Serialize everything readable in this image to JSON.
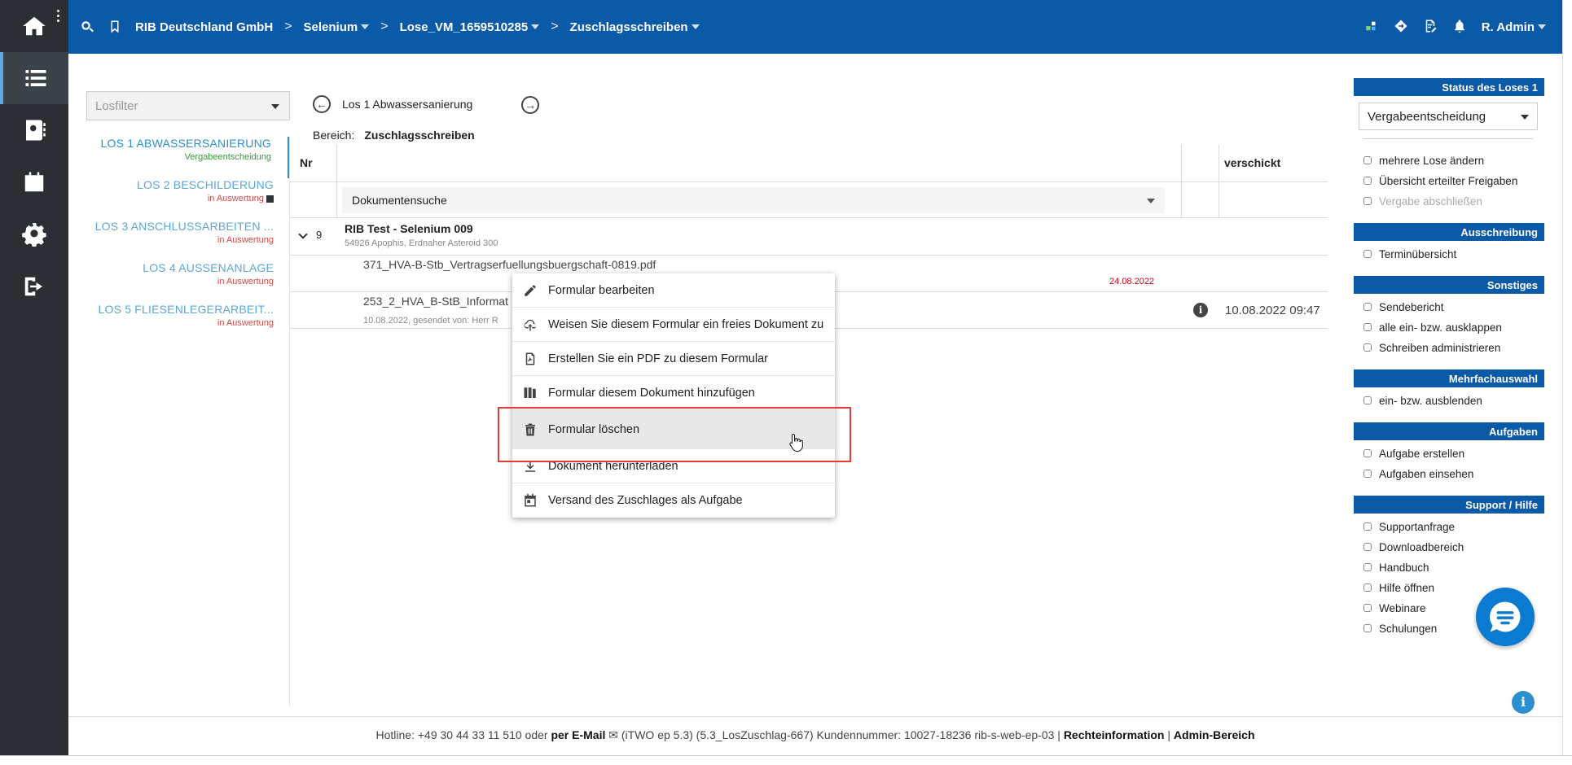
{
  "header": {
    "breadcrumbs": [
      {
        "label": "RIB Deutschland GmbH",
        "dropdown": false
      },
      {
        "label": "Selenium",
        "dropdown": true
      },
      {
        "label": "Lose_VM_1659510285",
        "dropdown": true
      },
      {
        "label": "Zuschlagsschreiben",
        "dropdown": true
      }
    ],
    "user": "R. Admin",
    "colors": {
      "bar": "#0a5aa8"
    }
  },
  "rail": {
    "icons": [
      "home-icon",
      "list-icon",
      "contact-book-icon",
      "calendar-icon",
      "gear-icon",
      "logout-icon"
    ]
  },
  "losfilter": {
    "placeholder": "Losfilter"
  },
  "lots": [
    {
      "name": "LOS 1 ABWASSERSANIERUNG",
      "status": "Vergabeentscheidung",
      "status_color": "#3b9a3b"
    },
    {
      "name": "LOS 2 BESCHILDERUNG",
      "status": "in Auswertung",
      "status_color": "#d14a4a"
    },
    {
      "name": "LOS 3 ANSCHLUSSARBEITEN ...",
      "status": "in Auswertung",
      "status_color": "#d14a4a"
    },
    {
      "name": "LOS 4 AUSSENANLAGE",
      "status": "in Auswertung",
      "status_color": "#d14a4a"
    },
    {
      "name": "LOS 5 FLIESENLEGERARBEIT...",
      "status": "in Auswertung",
      "status_color": "#d14a4a"
    }
  ],
  "main": {
    "current_lot": "Los 1 Abwassersanierung",
    "bereich_label": "Bereich:",
    "bereich_value": "Zuschlagsschreiben",
    "columns": {
      "nr": "Nr",
      "sent": "verschickt"
    },
    "docsearch": "Dokumentensuche",
    "group": {
      "number": "9",
      "title": "RIB Test - Selenium 009",
      "subtitle": "54926 Apophis, Erdnaher Asteroid 300"
    },
    "docs": [
      {
        "name": "371_HVA-B-Stb_Vertragserfuellungsbuergschaft-0819.pdf",
        "sub": "",
        "date_red": "24.08.2022",
        "sent": ""
      },
      {
        "name": "253_2_HVA_B-StB_Informat",
        "sub": "10.08.2022, gesendet von: Herr R",
        "date_red": "",
        "sent": "10.08.2022 09:47"
      }
    ]
  },
  "context_menu": {
    "items": [
      {
        "label": "Formular bearbeiten",
        "icon": "pencil-icon"
      },
      {
        "label": "Weisen Sie diesem Formular ein freies Dokument zu",
        "icon": "cloud-upload-icon"
      },
      {
        "label": "Erstellen Sie ein PDF zu diesem Formular",
        "icon": "pdf-file-icon"
      },
      {
        "label": "Formular diesem Dokument hinzufügen",
        "icon": "folder-add-icon"
      },
      {
        "label": "Formular löschen",
        "icon": "trash-icon"
      },
      {
        "label": "Dokument herunterladen",
        "icon": "download-icon"
      },
      {
        "label": "Versand des Zuschlages als Aufgabe",
        "icon": "calendar-task-icon"
      }
    ]
  },
  "rpanel": {
    "status_head": "Status des Loses 1",
    "status_value": "Vergabeentscheidung",
    "status_links": [
      {
        "label": "mehrere Lose ändern",
        "disabled": false
      },
      {
        "label": "Übersicht erteilter Freigaben",
        "disabled": false
      },
      {
        "label": "Vergabe abschließen",
        "disabled": true
      }
    ],
    "groups": [
      {
        "head": "Ausschreibung",
        "links": [
          "Terminübersicht"
        ]
      },
      {
        "head": "Sonstiges",
        "links": [
          "Sendebericht",
          "alle ein- bzw. ausklappen",
          "Schreiben administrieren"
        ]
      },
      {
        "head": "Mehrfachauswahl",
        "links": [
          "ein- bzw. ausblenden"
        ]
      },
      {
        "head": "Aufgaben",
        "links": [
          "Aufgabe erstellen",
          "Aufgaben einsehen"
        ]
      },
      {
        "head": "Support / Hilfe",
        "links": [
          "Supportanfrage",
          "Downloadbereich",
          "Handbuch",
          "Hilfe öffnen",
          "Webinare",
          "Schulungen"
        ]
      }
    ]
  },
  "footer": {
    "hotline": "Hotline: +49 30 44 33 11 510 oder",
    "email": "per E-Mail",
    "version": "(iTWO ep 5.3) (5.3_LosZuschlag-667)   Kundennummer: 10027-18236 rib-s-web-ep-03 |",
    "rights": "Rechteinformation",
    "pipe": "|",
    "admin": "Admin-Bereich"
  }
}
